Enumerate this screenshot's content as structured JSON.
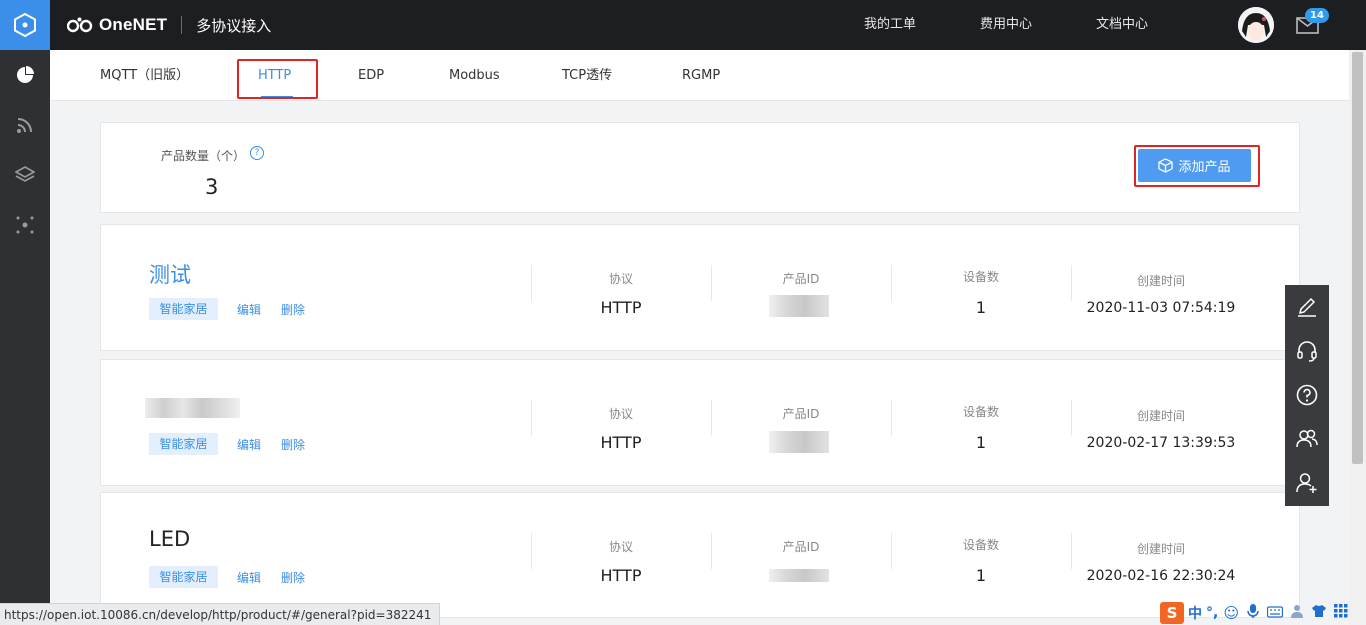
{
  "header": {
    "brand": "OneNET",
    "section": "多协议接入",
    "nav": [
      "我的工单",
      "费用中心",
      "文档中心"
    ],
    "mail_count": "14"
  },
  "tabs": [
    {
      "label": "MQTT（旧版）",
      "active": false
    },
    {
      "label": "HTTP",
      "active": true
    },
    {
      "label": "EDP",
      "active": false
    },
    {
      "label": "Modbus",
      "active": false
    },
    {
      "label": "TCP透传",
      "active": false
    },
    {
      "label": "RGMP",
      "active": false
    }
  ],
  "summary": {
    "label": "产品数量（个）",
    "help": "?",
    "count": "3",
    "add_button": "添加产品"
  },
  "columns": {
    "protocol": "协议",
    "product_id": "产品ID",
    "device_count": "设备数",
    "created": "创建时间"
  },
  "products": [
    {
      "name": "测试",
      "category": "智能家居",
      "edit": "编辑",
      "delete": "删除",
      "protocol": "HTTP",
      "devices": "1",
      "created": "2020-11-03 07:54:19"
    },
    {
      "name": "",
      "category": "智能家居",
      "edit": "编辑",
      "delete": "删除",
      "protocol": "HTTP",
      "devices": "1",
      "created": "2020-02-17 13:39:53"
    },
    {
      "name": "LED",
      "category": "智能家居",
      "edit": "编辑",
      "delete": "删除",
      "protocol": "HTTP",
      "devices": "1",
      "created": "2020-02-16 22:30:24"
    }
  ],
  "status_url": "https://open.iot.10086.cn/develop/http/product/#/general?pid=382241",
  "ime": {
    "logo": "S",
    "mode": "中",
    "punct": "°,"
  },
  "icons": {
    "rail": [
      "hexagon-logo-icon",
      "pie-chart-icon",
      "signal-icon",
      "layers-icon",
      "cluster-icon"
    ],
    "floatbar": [
      "edit-icon",
      "headset-icon",
      "help-icon",
      "users-icon",
      "add-user-icon"
    ]
  },
  "colors": {
    "accent": "#3a8ee6",
    "highlight_box": "#e02424",
    "topbar": "#1d1e21",
    "rail": "#2f3033",
    "logo_bg": "#3b8fe8"
  }
}
